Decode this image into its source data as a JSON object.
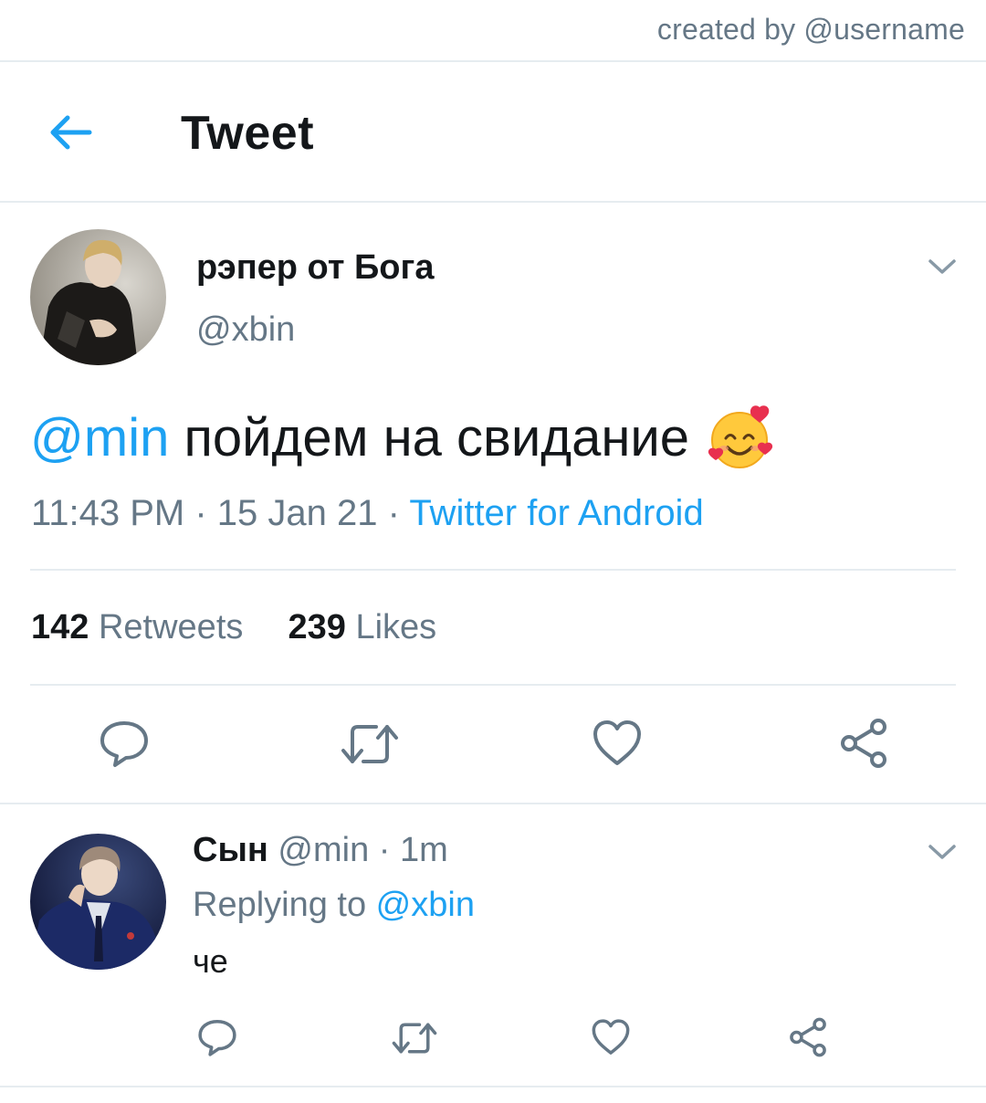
{
  "credit": "created by @username",
  "header": {
    "title": "Tweet"
  },
  "tweet": {
    "author_name": "рэпер от Бога",
    "author_handle": "@xbin",
    "mention": "@min",
    "text": " пойдем на свидание ",
    "emoji": "🥰",
    "time": "11:43 PM",
    "date": "15 Jan 21",
    "separator": " · ",
    "source": "Twitter for Android",
    "retweets_count": "142",
    "retweets_label": "Retweets",
    "likes_count": "239",
    "likes_label": "Likes"
  },
  "reply": {
    "author_name": "Сын",
    "author_handle": "@min",
    "age": "1m",
    "separator": " · ",
    "replying_label": "Replying to ",
    "replying_to": "@xbin",
    "text": "че"
  },
  "colors": {
    "accent": "#1da1f2",
    "secondary_text": "#657786",
    "icon": "#657786",
    "divider": "#e6ecf0"
  },
  "icons": [
    "arrow-left-icon",
    "chevron-down-icon",
    "reply-icon",
    "retweet-icon",
    "like-icon",
    "share-icon"
  ]
}
